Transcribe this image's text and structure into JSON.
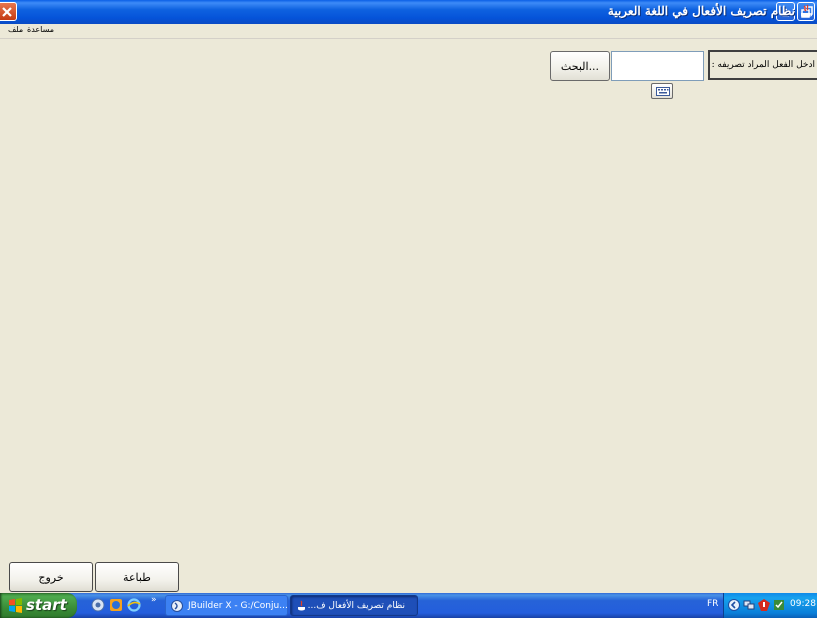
{
  "window": {
    "title": "نظام تصريف الأفعال في اللغة العربية"
  },
  "menu": {
    "file_label": "ملف",
    "help_label": "مساعدة"
  },
  "form": {
    "verb_label": "ادخل الفعل المراد تصريفه :",
    "verb_value": "",
    "search_label": "البحث...",
    "keyboard_icon": "keyboard-icon"
  },
  "footer": {
    "print_label": "طباعة",
    "exit_label": "خروج"
  },
  "taskbar": {
    "start_label": "start",
    "tasks": [
      {
        "label": "JBuilder X - G:/Conju...",
        "icon": "jbuilder-icon"
      },
      {
        "label": "نظام تصريف الأفعال ف...",
        "icon": "java-icon"
      }
    ],
    "language": "FR",
    "clock": "09:28"
  },
  "colors": {
    "window_bg": "#ece9d8",
    "titlebar": "#0553d9",
    "taskbar": "#245edc",
    "start_green": "#3a8c37",
    "tray": "#0a7fd9"
  }
}
